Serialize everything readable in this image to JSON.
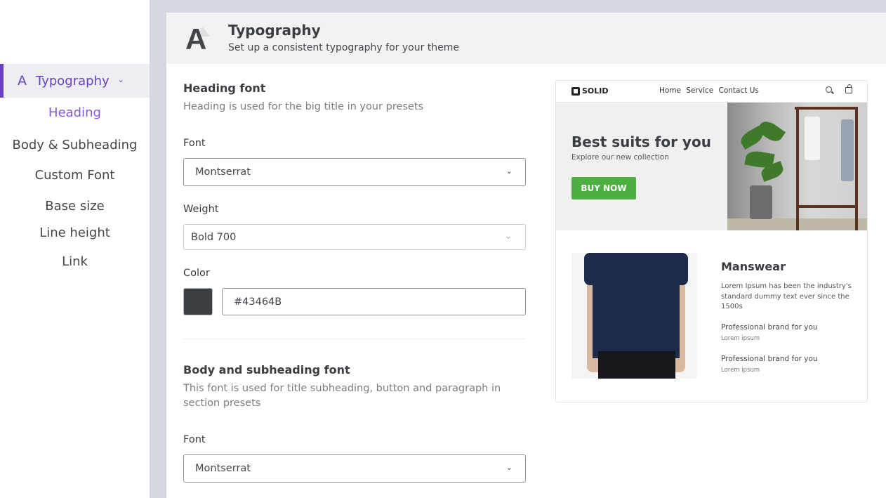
{
  "sidebar": {
    "active": {
      "label": "Typography"
    },
    "items": [
      {
        "label": "Heading"
      },
      {
        "label": "Body & Subheading"
      },
      {
        "label": "Custom Font"
      },
      {
        "label": "Base size"
      },
      {
        "label": "Line height"
      },
      {
        "label": "Link"
      }
    ]
  },
  "header": {
    "title": "Typography",
    "subtitle": "Set up a consistent typography for your theme"
  },
  "heading_font": {
    "title": "Heading font",
    "desc": "Heading is used for the big title in your presets",
    "font_label": "Font",
    "font_value": "Montserrat",
    "weight_label": "Weight",
    "weight_value": "Bold 700",
    "color_label": "Color",
    "color_value": "#43464B",
    "swatch_color": "#3b3e43"
  },
  "body_font": {
    "title": "Body and subheading font",
    "desc": "This font is used for title subheading, button and paragraph in section presets",
    "font_label": "Font",
    "font_value": "Montserrat"
  },
  "preview": {
    "logo": "SOLID",
    "nav": [
      "Home",
      "Service",
      "Contact Us"
    ],
    "hero_title": "Best suits for you",
    "hero_sub": "Explore our new collection",
    "cta": "BUY NOW",
    "product_title": "Manswear",
    "product_desc": "Lorem Ipsum has been the industry's standard dummy text ever since the 1500s",
    "features": [
      {
        "title": "Professional brand for you",
        "sub": "Lorem ipsum"
      },
      {
        "title": "Professional brand for you",
        "sub": "Lorem ipsum"
      }
    ]
  },
  "colors": {
    "accent": "#6a3fc0",
    "cta": "#4caf3f"
  }
}
